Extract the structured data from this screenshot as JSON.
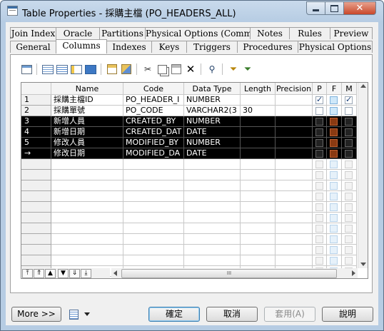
{
  "window": {
    "title": "Table Properties - 採購主檔 (PO_HEADERS_ALL)"
  },
  "window_buttons": {
    "close": "✕"
  },
  "tabs_row1": [
    "Join Index",
    "Oracle",
    "Partitions",
    "Physical Options (Common)",
    "Notes",
    "Rules",
    "Preview"
  ],
  "tabs_row2": [
    "General",
    "Columns",
    "Indexes",
    "Keys",
    "Triggers",
    "Procedures",
    "Physical Options"
  ],
  "active_tab": "Columns",
  "toolbar_icons": [
    "properties-icon",
    "add-row-icon",
    "insert-row-icon",
    "add-columns-icon",
    "replicate-icon",
    "paste-icon",
    "paste-special-icon",
    "cut-icon",
    "copy-icon",
    "paste-clip-icon",
    "delete-icon",
    "find-icon",
    "filter-icon",
    "filter-clear-icon"
  ],
  "grid": {
    "headers": [
      "Name",
      "Code",
      "Data Type",
      "Length",
      "Precision",
      "P",
      "F",
      "M"
    ],
    "rows": [
      {
        "num": "1",
        "name": "採購主檔ID",
        "code": "PO_HEADER_I",
        "type": "NUMBER",
        "length": "",
        "precision": "",
        "p": true,
        "f": false,
        "m": true,
        "selected": false
      },
      {
        "num": "2",
        "name": "採購單號",
        "code": "PO_CODE",
        "type": "VARCHAR2(3",
        "length": "30",
        "precision": "",
        "p": false,
        "f": false,
        "m": false,
        "selected": false
      },
      {
        "num": "3",
        "name": "新增人員",
        "code": "CREATED_BY",
        "type": "NUMBER",
        "length": "",
        "precision": "",
        "p": false,
        "f": false,
        "m": false,
        "selected": true
      },
      {
        "num": "4",
        "name": "新增日期",
        "code": "CREATED_DAT",
        "type": "DATE",
        "length": "",
        "precision": "",
        "p": false,
        "f": false,
        "m": false,
        "selected": true
      },
      {
        "num": "5",
        "name": "修改人員",
        "code": "MODIFIED_BY",
        "type": "NUMBER",
        "length": "",
        "precision": "",
        "p": false,
        "f": false,
        "m": false,
        "selected": true
      },
      {
        "num": "→",
        "name": "修改日期",
        "code": "MODIFIED_DA",
        "type": "DATE",
        "length": "",
        "precision": "",
        "p": false,
        "f": false,
        "m": false,
        "selected": true
      }
    ],
    "empty_rows": 11,
    "nav_buttons": [
      "⤒",
      "⇑",
      "▲",
      "▼",
      "⇓",
      "⤓"
    ],
    "hscroll_grip": "III"
  },
  "buttons": {
    "more": "More >>",
    "ok": "確定",
    "cancel": "取消",
    "apply": "套用(A)",
    "help": "說明"
  }
}
